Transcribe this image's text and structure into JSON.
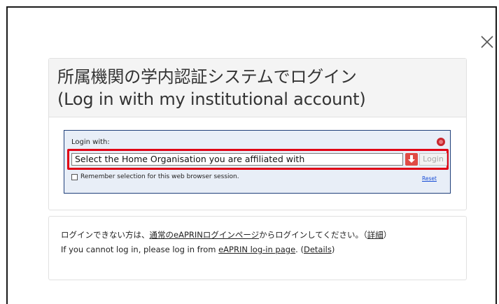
{
  "dialog": {
    "title_jp": "所属機関の学内認証システムでログイン",
    "title_en": "(Log in with my institutional account)"
  },
  "wayf": {
    "login_with_label": "Login with:",
    "org_select_value": "Select the Home Organisation you are affiliated with",
    "login_button": "Login",
    "remember_label": "Remember selection for this web browser session.",
    "reset_link": "Reset"
  },
  "help": {
    "jp_prefix": "ログインできない方は、",
    "jp_link": "通常のeAPRINログインページ",
    "jp_middle": "からログインしてください。（",
    "jp_details": "詳細",
    "jp_suffix": "）",
    "en_prefix": "If you cannot log in, please log in from ",
    "en_link": "eAPRIN log-in page",
    "en_middle": ". (",
    "en_details": "Details",
    "en_suffix": ")"
  },
  "colors": {
    "highlight_border": "#e00015",
    "wayf_border": "#1f3f7a",
    "wayf_background": "#e8eef7",
    "link_color": "#1a4fd6"
  },
  "icons": {
    "close": "close-icon",
    "help": "help-icon",
    "dropdown": "dropdown-arrow-icon"
  }
}
